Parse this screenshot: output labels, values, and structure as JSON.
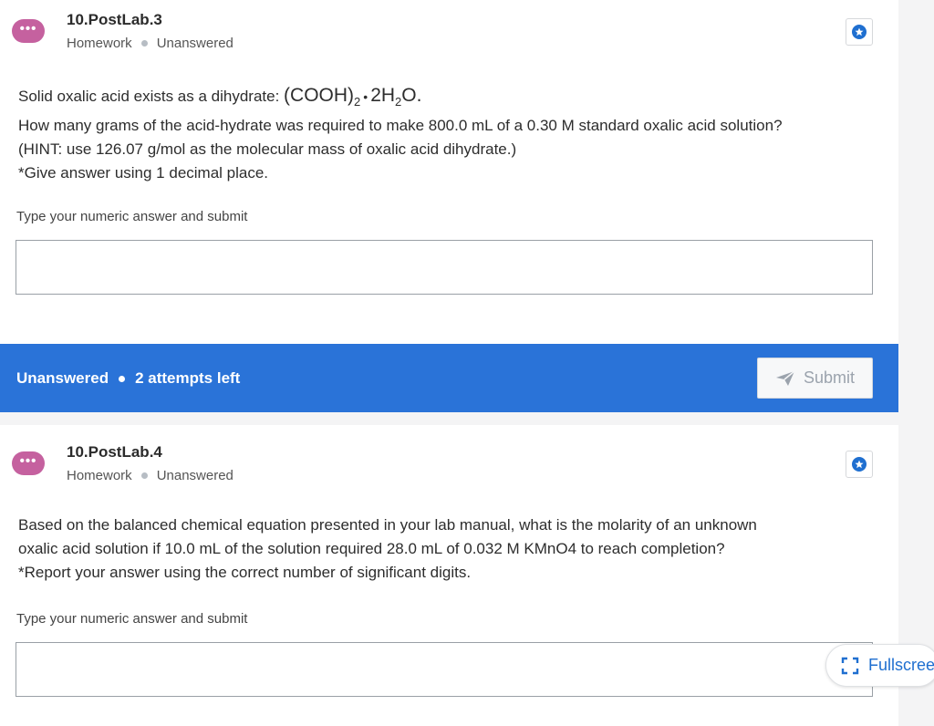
{
  "questions": [
    {
      "title": "10.PostLab.3",
      "type": "Homework",
      "status": "Unanswered",
      "avatar_icon": "more-dots-icon",
      "text_intro": "Solid oxalic acid exists as a dihydrate: ",
      "formula": {
        "cooh": "(COOH)",
        "sub1": "2",
        "bullet": "•",
        "water_pre": "2H",
        "sub2": "2",
        "water_post": "O."
      },
      "lines": [
        "How many grams of the acid-hydrate was required to make 800.0 mL of a 0.30 M standard oxalic acid solution?",
        "(HINT: use 126.07 g/mol as the molecular mass of oxalic acid dihydrate.)",
        "*Give answer using 1 decimal place."
      ],
      "answer_label": "Type your numeric answer and submit",
      "answer_value": ""
    },
    {
      "title": "10.PostLab.4",
      "type": "Homework",
      "status": "Unanswered",
      "avatar_icon": "more-dots-icon",
      "lines": [
        "Based on the balanced chemical equation presented in your lab manual, what is the molarity of an unknown",
        "oxalic acid solution if 10.0 mL of the solution required 28.0 mL of 0.032 M KMnO4 to reach completion?",
        "*Report your answer using the correct number of significant digits."
      ],
      "answer_label": "Type your numeric answer and submit",
      "answer_value": ""
    }
  ],
  "status_bar": {
    "status": "Unanswered",
    "attempts": "2 attempts left",
    "submit_label": "Submit"
  },
  "fullscreen": {
    "label": "Fullscreen"
  },
  "colors": {
    "accent": "#2a73d8",
    "avatar": "#c5619f"
  }
}
